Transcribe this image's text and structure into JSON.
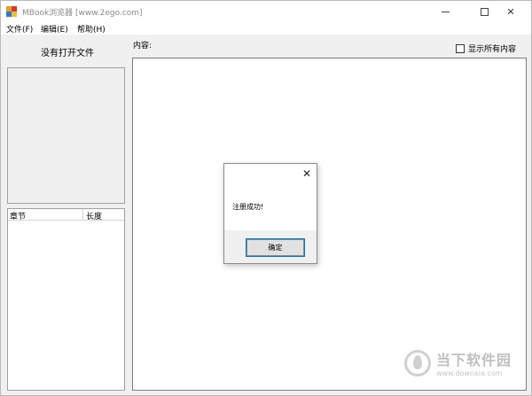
{
  "window": {
    "title": "MBook浏览器 [www.2ego.com]",
    "icon": "app-icon",
    "controls": {
      "minimize": "minimize-icon",
      "maximize": "maximize-icon",
      "close": "✕"
    }
  },
  "menu": {
    "file": "文件(F)",
    "edit": "编辑(E)",
    "help": "帮助(H)"
  },
  "left_panel": {
    "status": "没有打开文件",
    "list_columns": [
      "章节",
      "长度"
    ]
  },
  "content": {
    "label": "内容:",
    "show_all_label": "显示所有内容",
    "show_all_checked": false
  },
  "dialog": {
    "close": "✕",
    "message": "注册成功!",
    "ok_label": "确定"
  },
  "watermark": {
    "name": "当下软件园",
    "url": "www.downxia.com"
  },
  "colors": {
    "accent": "#0078d7",
    "window_bg": "#f0f0f0",
    "border": "#a0a0a0"
  }
}
